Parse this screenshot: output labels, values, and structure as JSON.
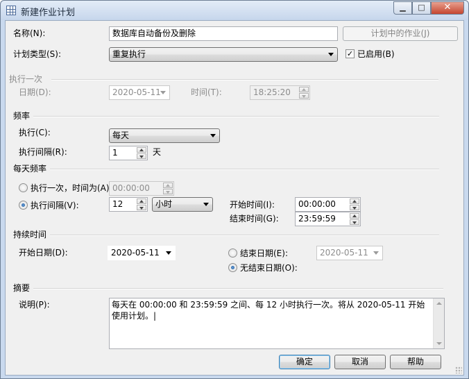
{
  "window": {
    "title": "新建作业计划",
    "minimize_glyph": "▁",
    "maximize_glyph": "□",
    "close_glyph": "✕"
  },
  "general": {
    "name_label": "名称(N):",
    "name_value": "数据库自动备份及删除",
    "scheduled_jobs_button": "计划中的作业(J)",
    "schedule_type_label": "计划类型(S):",
    "schedule_type_value": "重复执行",
    "enabled_label": "已启用(B)",
    "enabled_checked": true
  },
  "one_time": {
    "section_title": "执行一次",
    "date_label": "日期(D):",
    "date_value": "2020-05-11",
    "time_label": "时间(T):",
    "time_value": "18:25:20"
  },
  "frequency": {
    "section_title": "频率",
    "occurs_label": "执行(C):",
    "occurs_value": "每天",
    "recur_label": "执行间隔(R):",
    "recur_value": "1",
    "recur_unit": "天"
  },
  "daily_frequency": {
    "section_title": "每天频率",
    "once_label": "执行一次，时间为(A)",
    "once_time": "00:00:00",
    "every_label": "执行间隔(V):",
    "every_value": "12",
    "every_unit": "小时",
    "selected_option": "every",
    "start_time_label": "开始时间(I):",
    "start_time_value": "00:00:00",
    "end_time_label": "结束时间(G):",
    "end_time_value": "23:59:59"
  },
  "duration": {
    "section_title": "持续时间",
    "start_date_label": "开始日期(D):",
    "start_date_value": "2020-05-11",
    "end_date_label": "结束日期(E):",
    "end_date_value": "2020-05-11",
    "no_end_date_label": "无结束日期(O):",
    "selected_option": "no_end_date"
  },
  "summary": {
    "section_title": "摘要",
    "description_label": "说明(P):",
    "description_text": "每天在 00:00:00 和 23:59:59 之间、每 12 小时执行一次。将从 2020-05-11 开始使用计划。|"
  },
  "footer": {
    "ok_label": "确定",
    "cancel_label": "取消",
    "help_label": "帮助"
  }
}
